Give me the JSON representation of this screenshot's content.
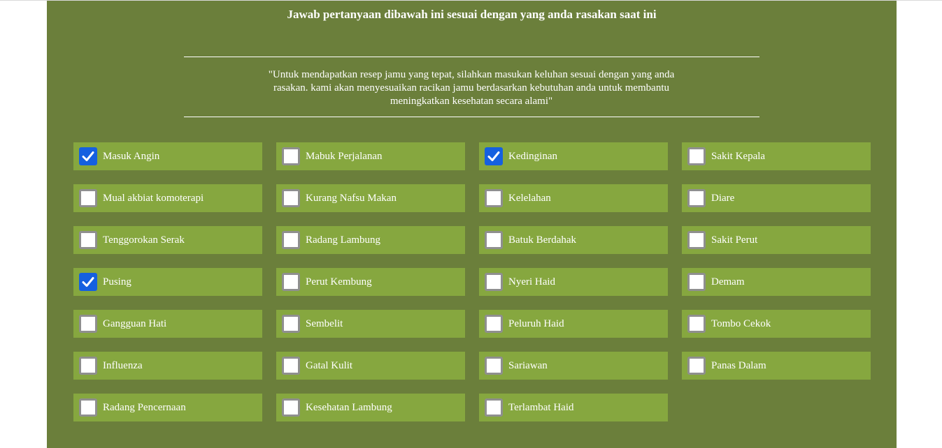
{
  "page": {
    "title": "Jawab pertanyaan dibawah ini sesuai dengan yang anda rasakan saat ini",
    "quote": "\"Untuk mendapatkan resep jamu yang tepat, silahkan masukan keluhan sesuai dengan yang anda rasakan. kami akan menyesuaikan racikan jamu berdasarkan kebutuhan anda untuk membantu meningkatkan kesehatan secara alami\""
  },
  "colors": {
    "panel": "#6b7f3b",
    "item": "#86a73f",
    "checked": "#1560e0"
  },
  "symptoms": [
    {
      "label": "Masuk Angin",
      "checked": true
    },
    {
      "label": "Mabuk Perjalanan",
      "checked": false
    },
    {
      "label": "Kedinginan",
      "checked": true
    },
    {
      "label": "Sakit Kepala",
      "checked": false
    },
    {
      "label": "Mual akbiat komoterapi",
      "checked": false
    },
    {
      "label": "Kurang Nafsu Makan",
      "checked": false
    },
    {
      "label": "Kelelahan",
      "checked": false
    },
    {
      "label": "Diare",
      "checked": false
    },
    {
      "label": "Tenggorokan Serak",
      "checked": false
    },
    {
      "label": "Radang Lambung",
      "checked": false
    },
    {
      "label": "Batuk Berdahak",
      "checked": false
    },
    {
      "label": "Sakit Perut",
      "checked": false
    },
    {
      "label": "Pusing",
      "checked": true
    },
    {
      "label": "Perut Kembung",
      "checked": false
    },
    {
      "label": "Nyeri Haid",
      "checked": false
    },
    {
      "label": "Demam",
      "checked": false
    },
    {
      "label": "Gangguan Hati",
      "checked": false
    },
    {
      "label": "Sembelit",
      "checked": false
    },
    {
      "label": "Peluruh Haid",
      "checked": false
    },
    {
      "label": "Tombo Cekok",
      "checked": false
    },
    {
      "label": "Influenza",
      "checked": false
    },
    {
      "label": "Gatal Kulit",
      "checked": false
    },
    {
      "label": "Sariawan",
      "checked": false
    },
    {
      "label": "Panas Dalam",
      "checked": false
    },
    {
      "label": "Radang Pencernaan",
      "checked": false
    },
    {
      "label": "Kesehatan Lambung",
      "checked": false
    },
    {
      "label": "Terlambat Haid",
      "checked": false
    }
  ]
}
